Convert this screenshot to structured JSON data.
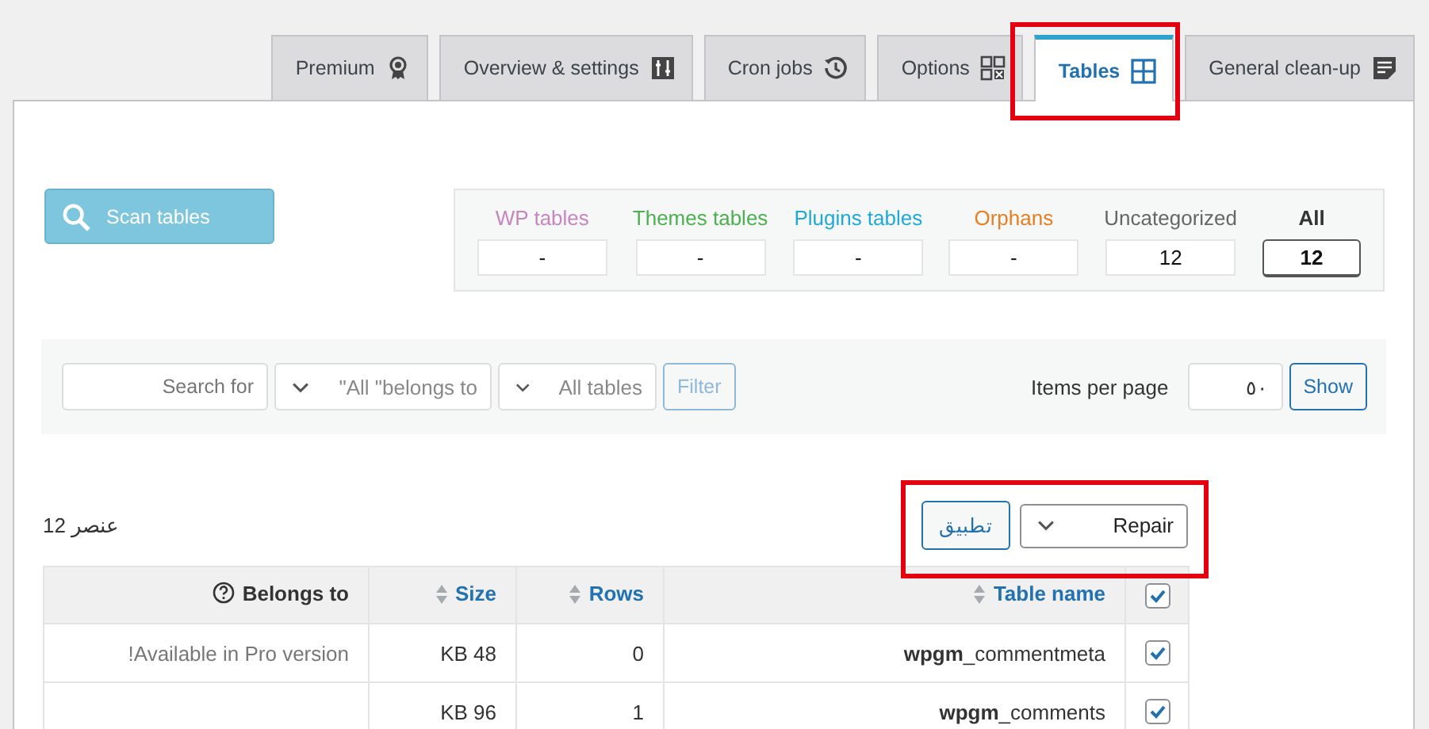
{
  "tabs": [
    {
      "label": "Premium",
      "selected": false
    },
    {
      "label": "Overview & settings",
      "selected": false
    },
    {
      "label": "Cron jobs",
      "selected": false
    },
    {
      "label": "Options",
      "selected": false
    },
    {
      "label": "Tables",
      "selected": true
    },
    {
      "label": "General clean-up",
      "selected": false
    }
  ],
  "scan_button": "Scan tables",
  "categories": [
    {
      "label": "WP tables",
      "color": "#c586c0",
      "value": "-",
      "selected": false
    },
    {
      "label": "Themes tables",
      "color": "#4caf50",
      "value": "-",
      "selected": false
    },
    {
      "label": "Plugins tables",
      "color": "#1fa9d6",
      "value": "-",
      "selected": false
    },
    {
      "label": "Orphans",
      "color": "#e67e22",
      "value": "-",
      "selected": false
    },
    {
      "label": "Uncategorized",
      "color": "#666666",
      "value": "12",
      "selected": false
    },
    {
      "label": "All",
      "color": "#333333",
      "value": "12",
      "selected": true
    }
  ],
  "filter": {
    "search_placeholder": "Search for",
    "belongs_select": "\"All \"belongs to",
    "tables_select": "All tables",
    "filter_button": "Filter"
  },
  "items_per_page": {
    "label": "Items per page",
    "value": "٥٠",
    "button": "Show"
  },
  "count": "12 عنصر",
  "bulk_action": {
    "value": "Repair",
    "apply": "تطبيق"
  },
  "table": {
    "select_all_checked": true,
    "columns": [
      {
        "label": "Belongs to",
        "kind": "help"
      },
      {
        "label": "Size",
        "kind": "sortable"
      },
      {
        "label": "Rows",
        "kind": "sortable"
      },
      {
        "label": "Table name",
        "kind": "sortable"
      }
    ],
    "rows": [
      {
        "belongs_to": "!Available in Pro version",
        "size": "KB 48",
        "rows": "0",
        "table_name": "**wpgm**_commentmeta",
        "checked": true
      },
      {
        "size": "KB 96",
        "rows": "1",
        "table_name": "**wpgm**_comments",
        "checked": true
      }
    ]
  }
}
